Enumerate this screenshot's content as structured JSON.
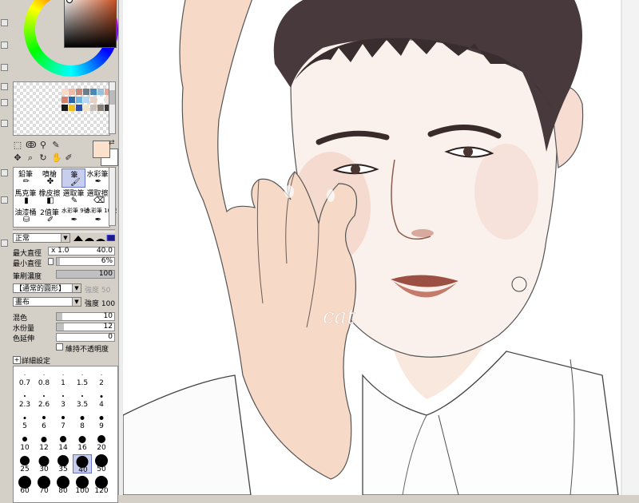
{
  "color_wheel": {
    "hue_ring": "rainbow",
    "selected_color": "#d85a28"
  },
  "palette": {
    "swatches": [
      "#f7d9cc",
      "#eebba8",
      "#c88b79",
      "#6c7d8a",
      "#4a86b8",
      "#98c2dc",
      "#e9a692",
      "#d87f6a",
      "#2b66a8",
      "#6db5e3",
      "#b7d8ef",
      "#e6d0c6",
      "#ffffff",
      "#f0e0d8",
      "#1a1a1a",
      "#f0c020",
      "#2d4fa8",
      "#f2e6c8",
      "#c9c1b8",
      "#8a7f75",
      "#3a3a3a"
    ]
  },
  "tools": {
    "icons": [
      "marquee-icon",
      "lasso-icon",
      "magic-wand-icon",
      "eyedropper-icon",
      "move-icon",
      "zoom-icon",
      "rotate-icon",
      "hand-icon",
      "color-picker-icon"
    ]
  },
  "current_colors": {
    "foreground": "#fbe0cc",
    "background": "#ffffff"
  },
  "brushes": [
    {
      "label": "鉛筆",
      "icon": "pencil-icon"
    },
    {
      "label": "噴槍",
      "icon": "airbrush-icon"
    },
    {
      "label": "筆",
      "icon": "brush-icon",
      "selected": true
    },
    {
      "label": "水彩筆",
      "icon": "watercolor-icon"
    },
    {
      "label": "馬克筆",
      "icon": "marker-icon"
    },
    {
      "label": "橡皮擦",
      "icon": "eraser-icon"
    },
    {
      "label": "選取筆",
      "icon": "select-pen-icon"
    },
    {
      "label": "選取擦",
      "icon": "select-eraser-icon"
    },
    {
      "label": "油漆桶",
      "icon": "bucket-icon"
    },
    {
      "label": "2值筆",
      "icon": "binary-pen-icon"
    },
    {
      "label": "水彩筆 9號",
      "icon": "watercolor9-icon"
    },
    {
      "label": "水彩筆 10號",
      "icon": "watercolor10-icon"
    }
  ],
  "blend_mode": {
    "value": "正常"
  },
  "settings": {
    "max_size_label": "最大直徑",
    "max_size_multiplier": "x 1.0",
    "max_size_value": "40.0",
    "min_size_label": "最小直徑",
    "min_size_value": "6%",
    "min_size_fill": 0.06,
    "density_label": "筆刷濃度",
    "density_value": "100",
    "density_fill": 1.0,
    "shape_select": "【通常的圓形】",
    "shape_strength_label": "強度",
    "shape_strength_value": "50",
    "texture_select": "畫布",
    "texture_strength_label": "強度",
    "texture_strength_value": "100",
    "blending_label": "混色",
    "blending_value": "10",
    "blending_fill": 0.1,
    "water_label": "水份量",
    "water_value": "12",
    "water_fill": 0.12,
    "persistence_label": "色延伸",
    "persistence_value": "0",
    "persistence_fill": 0.0,
    "keep_opacity_label": "維持不透明度",
    "advanced_label": "詳細設定"
  },
  "brush_sizes": [
    {
      "label": "0.7",
      "dot": 1
    },
    {
      "label": "0.8",
      "dot": 1
    },
    {
      "label": "1",
      "dot": 1
    },
    {
      "label": "1.5",
      "dot": 1
    },
    {
      "label": "2",
      "dot": 1
    },
    {
      "label": "2.3",
      "dot": 2
    },
    {
      "label": "2.6",
      "dot": 2
    },
    {
      "label": "3",
      "dot": 2
    },
    {
      "label": "3.5",
      "dot": 2
    },
    {
      "label": "4",
      "dot": 3
    },
    {
      "label": "5",
      "dot": 3
    },
    {
      "label": "6",
      "dot": 4
    },
    {
      "label": "7",
      "dot": 4
    },
    {
      "label": "8",
      "dot": 5
    },
    {
      "label": "9",
      "dot": 5
    },
    {
      "label": "10",
      "dot": 6
    },
    {
      "label": "12",
      "dot": 7
    },
    {
      "label": "14",
      "dot": 8
    },
    {
      "label": "16",
      "dot": 9
    },
    {
      "label": "20",
      "dot": 10
    },
    {
      "label": "25",
      "dot": 12
    },
    {
      "label": "30",
      "dot": 13
    },
    {
      "label": "35",
      "dot": 14
    },
    {
      "label": "40",
      "dot": 15,
      "selected": true
    },
    {
      "label": "50",
      "dot": 16
    },
    {
      "label": "60",
      "dot": 16
    },
    {
      "label": "70",
      "dot": 16
    },
    {
      "label": "80",
      "dot": 16
    },
    {
      "label": "100",
      "dot": 16
    },
    {
      "label": "120",
      "dot": 16
    }
  ],
  "canvas": {
    "signature": "cat"
  }
}
